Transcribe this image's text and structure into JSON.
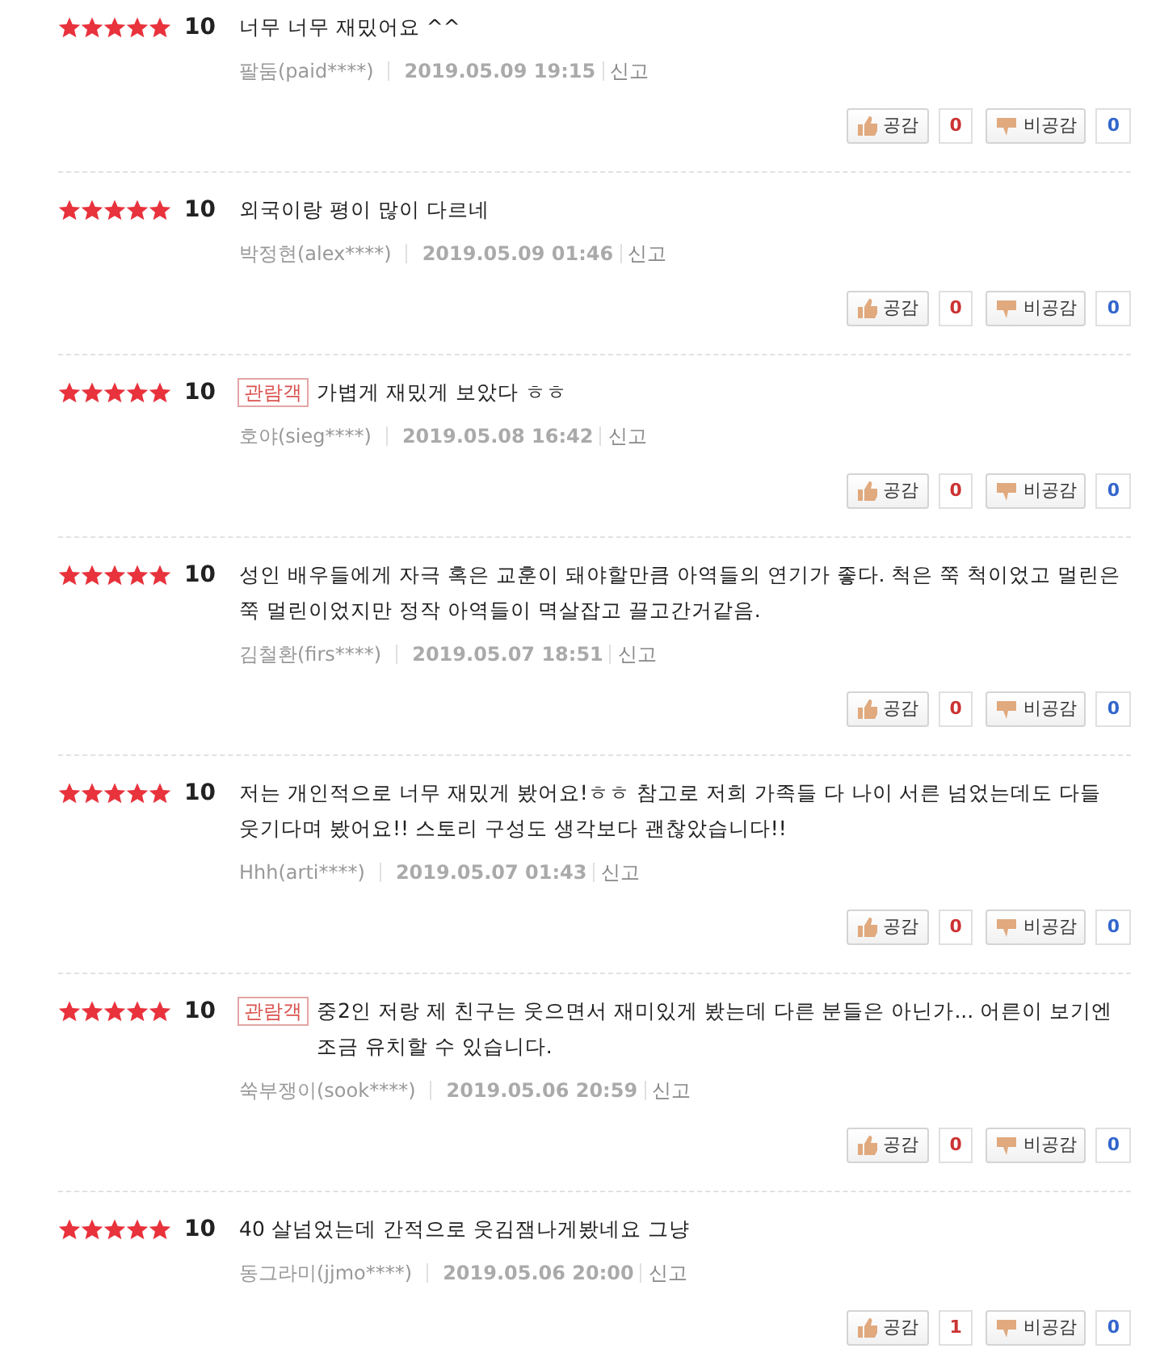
{
  "reviews": [
    {
      "stars": 5,
      "score": "10",
      "text": "너무 너무 재밌어요 ^^",
      "author": "팔둠(paid****)",
      "date": "2019.05.09 19:15",
      "report": "신고",
      "like_label": "공감",
      "likes": "0",
      "dislike_label": "비공감",
      "dislikes": "0"
    },
    {
      "stars": 5,
      "score": "10",
      "text": "외국이랑 평이 많이 다르네",
      "author": "박정현(alex****)",
      "date": "2019.05.09 01:46",
      "report": "신고",
      "like_label": "공감",
      "likes": "0",
      "dislike_label": "비공감",
      "dislikes": "0"
    },
    {
      "stars": 5,
      "score": "10",
      "badge": "관람객",
      "text": "가볍게 재밌게 보았다 ㅎㅎ",
      "author": "호야(sieg****)",
      "date": "2019.05.08 16:42",
      "report": "신고",
      "like_label": "공감",
      "likes": "0",
      "dislike_label": "비공감",
      "dislikes": "0"
    },
    {
      "stars": 5,
      "score": "10",
      "text": "성인 배우들에게 자극 혹은 교훈이 돼야할만큼 아역들의 연기가 좋다. 척은 쭉 척이었고 멀린은 쭉 멀린이었지만 정작 아역들이 멱살잡고 끌고간거같음.",
      "author": "김철환(firs****)",
      "date": "2019.05.07 18:51",
      "report": "신고",
      "like_label": "공감",
      "likes": "0",
      "dislike_label": "비공감",
      "dislikes": "0"
    },
    {
      "stars": 5,
      "score": "10",
      "text": "저는 개인적으로 너무 재밌게 봤어요!ㅎㅎ 참고로 저희 가족들 다 나이 서른 넘었는데도 다들 웃기다며 봤어요!! 스토리 구성도 생각보다 괜찮았습니다!!",
      "author": "Hhh(arti****)",
      "date": "2019.05.07 01:43",
      "report": "신고",
      "like_label": "공감",
      "likes": "0",
      "dislike_label": "비공감",
      "dislikes": "0"
    },
    {
      "stars": 5,
      "score": "10",
      "badge": "관람객",
      "text": "중2인 저랑 제 친구는 웃으면서 재미있게 봤는데 다른 분들은 아닌가... 어른이 보기엔 조금 유치할 수 있습니다.",
      "author": "쑥부쟁이(sook****)",
      "date": "2019.05.06 20:59",
      "report": "신고",
      "like_label": "공감",
      "likes": "0",
      "dislike_label": "비공감",
      "dislikes": "0"
    },
    {
      "stars": 5,
      "score": "10",
      "text": "40 살넘었는데 간적으로 웃김잼나게봤네요 그냥",
      "author": "동그라미(jjmo****)",
      "date": "2019.05.06 20:00",
      "report": "신고",
      "like_label": "공감",
      "likes": "1",
      "dislike_label": "비공감",
      "dislikes": "0"
    }
  ]
}
